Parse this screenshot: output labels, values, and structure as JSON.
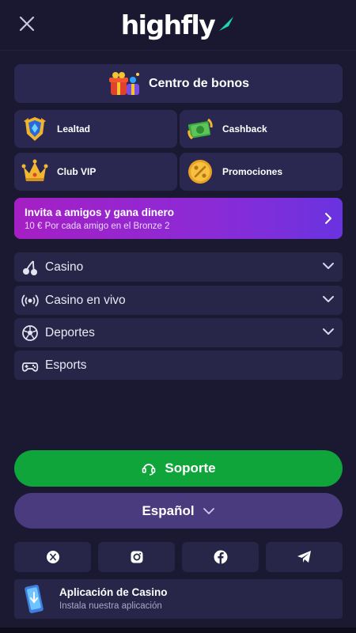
{
  "header": {
    "logo_part1": "high",
    "logo_part2": "fly",
    "close_icon": "close-icon"
  },
  "bonus_center": {
    "label": "Centro de bonos",
    "icon": "gift-icon"
  },
  "tiles": [
    {
      "label": "Lealtad",
      "icon": "shield-badge-icon"
    },
    {
      "label": "Cashback",
      "icon": "cashback-icon"
    },
    {
      "label": "Club VIP",
      "icon": "crown-icon"
    },
    {
      "label": "Promociones",
      "icon": "percent-coin-icon"
    }
  ],
  "invite": {
    "title": "Invita a amigos y gana dinero",
    "subtitle": "10 € Por cada amigo en el Bronze 2"
  },
  "nav": [
    {
      "label": "Casino",
      "icon": "cherries-icon",
      "expandable": true
    },
    {
      "label": "Casino en vivo",
      "icon": "live-broadcast-icon",
      "expandable": true
    },
    {
      "label": "Deportes",
      "icon": "soccer-ball-icon",
      "expandable": true
    },
    {
      "label": "Esports",
      "icon": "gamepad-icon",
      "expandable": false
    }
  ],
  "support": {
    "label": "Soporte",
    "icon": "headset-icon"
  },
  "language": {
    "label": "Español"
  },
  "social": [
    "x-icon",
    "instagram-icon",
    "facebook-icon",
    "telegram-icon"
  ],
  "app_banner": {
    "title": "Aplicación de Casino",
    "subtitle": "Instala nuestra aplicación"
  },
  "colors": {
    "background": "#1b1932",
    "card": "#2a2850",
    "support_green": "#0fa53b",
    "language_purple": "#4a3b7e",
    "invite_gradient_start": "#a51fc4",
    "invite_gradient_end": "#6a33e0",
    "logo_accent": "#19d9b6"
  }
}
